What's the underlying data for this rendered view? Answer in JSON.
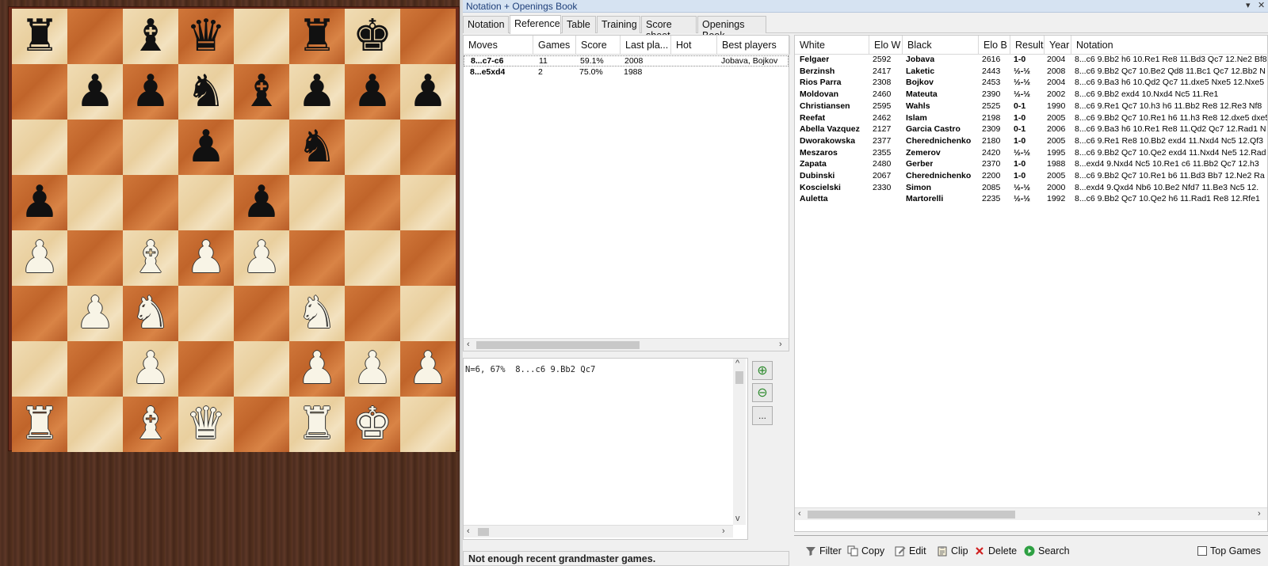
{
  "window": {
    "title": "Notation + Openings Book",
    "minimize_glyph": "▾",
    "close_glyph": "✕"
  },
  "tabs": [
    {
      "label": "Notation"
    },
    {
      "label": "Reference"
    },
    {
      "label": "Table"
    },
    {
      "label": "Training"
    },
    {
      "label": "Score sheet"
    },
    {
      "label": "Openings Book"
    }
  ],
  "board": {
    "rows": [
      [
        "bR",
        "",
        "bB",
        "bQ",
        "",
        "bR",
        "bK",
        ""
      ],
      [
        "",
        "bP",
        "bP",
        "bN",
        "bB",
        "bP",
        "bP",
        "bP"
      ],
      [
        "",
        "",
        "",
        "bP",
        "",
        "bN",
        "",
        ""
      ],
      [
        "bP",
        "",
        "",
        "",
        "bP",
        "",
        "",
        ""
      ],
      [
        "wP",
        "",
        "wB",
        "wP",
        "wP",
        "",
        "",
        ""
      ],
      [
        "",
        "wP",
        "wN",
        "",
        "",
        "wN",
        "",
        ""
      ],
      [
        "",
        "",
        "wP",
        "",
        "",
        "wP",
        "wP",
        "wP"
      ],
      [
        "wR",
        "",
        "wB",
        "wQ",
        "",
        "wR",
        "wK",
        ""
      ]
    ],
    "glyphs": {
      "R": "♜",
      "N": "♞",
      "B": "♝",
      "Q": "♛",
      "K": "♚",
      "P": "♟"
    },
    "colors": {
      "light": "#ecd5a6",
      "dark": "#c86a31",
      "frame": "#6b2a1a"
    }
  },
  "moves_table": {
    "headers": [
      "Moves",
      "Games",
      "Score",
      "Last pla...",
      "Hot",
      "Best players"
    ],
    "rows": [
      {
        "move": "8...c7-c6",
        "games": "11",
        "score": "59.1%",
        "last": "2008",
        "hot": "",
        "best": "Jobava, Bojkov"
      },
      {
        "move": "8...e5xd4",
        "games": "2",
        "score": "75.0%",
        "last": "1988",
        "hot": "",
        "best": ""
      }
    ]
  },
  "info": {
    "text": "N=6, 67%  8...c6 9.Bb2 Qc7"
  },
  "side_buttons": [
    {
      "icon": "zoom-in-icon",
      "glyph": "⊕"
    },
    {
      "icon": "zoom-out-icon",
      "glyph": "⊖"
    },
    {
      "icon": "more-icon",
      "glyph": "..."
    }
  ],
  "status": {
    "text": "Not enough recent grandmaster games."
  },
  "games_table": {
    "headers": [
      "White",
      "Elo W",
      "Black",
      "Elo B",
      "Result",
      "Year",
      "Notation"
    ],
    "rows": [
      {
        "white": "Felgaer",
        "elo_w": "2592",
        "black": "Jobava",
        "elo_b": "2616",
        "result": "1-0",
        "year": "2004",
        "notation": "8...c6 9.Bb2 h6 10.Re1 Re8 11.Bd3 Qc7 12.Ne2 Bf8"
      },
      {
        "white": "Berzinsh",
        "elo_w": "2417",
        "black": "Laketic",
        "elo_b": "2443",
        "result": "½-½",
        "year": "2008",
        "notation": "8...c6 9.Bb2 Qc7 10.Be2 Qd8 11.Bc1 Qc7 12.Bb2 N"
      },
      {
        "white": "Rios Parra",
        "elo_w": "2308",
        "black": "Bojkov",
        "elo_b": "2453",
        "result": "½-½",
        "year": "2004",
        "notation": "8...c6 9.Ba3 h6 10.Qd2 Qc7 11.dxe5 Nxe5 12.Nxe5"
      },
      {
        "white": "Moldovan",
        "elo_w": "2460",
        "black": "Mateuta",
        "elo_b": "2390",
        "result": "½-½",
        "year": "2002",
        "notation": "8...c6 9.Bb2 exd4 10.Nxd4 Nc5 11.Re1"
      },
      {
        "white": "Christiansen",
        "elo_w": "2595",
        "black": "Wahls",
        "elo_b": "2525",
        "result": "0-1",
        "year": "1990",
        "notation": "8...c6 9.Re1 Qc7 10.h3 h6 11.Bb2 Re8 12.Re3 Nf8"
      },
      {
        "white": "Reefat",
        "elo_w": "2462",
        "black": "Islam",
        "elo_b": "2198",
        "result": "1-0",
        "year": "2005",
        "notation": "8...c6 9.Bb2 Qc7 10.Re1 h6 11.h3 Re8 12.dxe5 dxe5"
      },
      {
        "white": "Abella Vazquez",
        "elo_w": "2127",
        "black": "Garcia Castro",
        "elo_b": "2309",
        "result": "0-1",
        "year": "2006",
        "notation": "8...c6 9.Ba3 h6 10.Re1 Re8 11.Qd2 Qc7 12.Rad1 N"
      },
      {
        "white": "Dworakowska",
        "elo_w": "2377",
        "black": "Cherednichenko",
        "elo_b": "2180",
        "result": "1-0",
        "year": "2005",
        "notation": "8...c6 9.Re1 Re8 10.Bb2 exd4 11.Nxd4 Nc5 12.Qf3"
      },
      {
        "white": "Meszaros",
        "elo_w": "2355",
        "black": "Zemerov",
        "elo_b": "2420",
        "result": "½-½",
        "year": "1995",
        "notation": "8...c6 9.Bb2 Qc7 10.Qe2 exd4 11.Nxd4 Ne5 12.Rad"
      },
      {
        "white": "Zapata",
        "elo_w": "2480",
        "black": "Gerber",
        "elo_b": "2370",
        "result": "1-0",
        "year": "1988",
        "notation": "8...exd4 9.Nxd4 Nc5 10.Re1 c6 11.Bb2 Qc7 12.h3"
      },
      {
        "white": "Dubinski",
        "elo_w": "2067",
        "black": "Cherednichenko",
        "elo_b": "2200",
        "result": "1-0",
        "year": "2005",
        "notation": "8...c6 9.Bb2 Qc7 10.Re1 b6 11.Bd3 Bb7 12.Ne2 Ra"
      },
      {
        "white": "Koscielski",
        "elo_w": "2330",
        "black": "Simon",
        "elo_b": "2085",
        "result": "½-½",
        "year": "2000",
        "notation": "8...exd4 9.Qxd4 Nb6 10.Be2 Nfd7 11.Be3 Nc5 12."
      },
      {
        "white": "Auletta",
        "elo_w": "",
        "black": "Martorelli",
        "elo_b": "2235",
        "result": "½-½",
        "year": "1992",
        "notation": "8...c6 9.Bb2 Qc7 10.Qe2 h6 11.Rad1 Re8 12.Rfe1"
      }
    ]
  },
  "toolbar": [
    {
      "label": "Filter",
      "icon": "filter-icon"
    },
    {
      "label": "Copy",
      "icon": "copy-icon"
    },
    {
      "label": "Edit",
      "icon": "edit-icon"
    },
    {
      "label": "Clip",
      "icon": "clipboard-icon"
    },
    {
      "label": "Delete",
      "icon": "delete-icon"
    },
    {
      "label": "Search",
      "icon": "search-icon"
    }
  ],
  "top_games": {
    "label": "Top Games",
    "checked": false
  }
}
